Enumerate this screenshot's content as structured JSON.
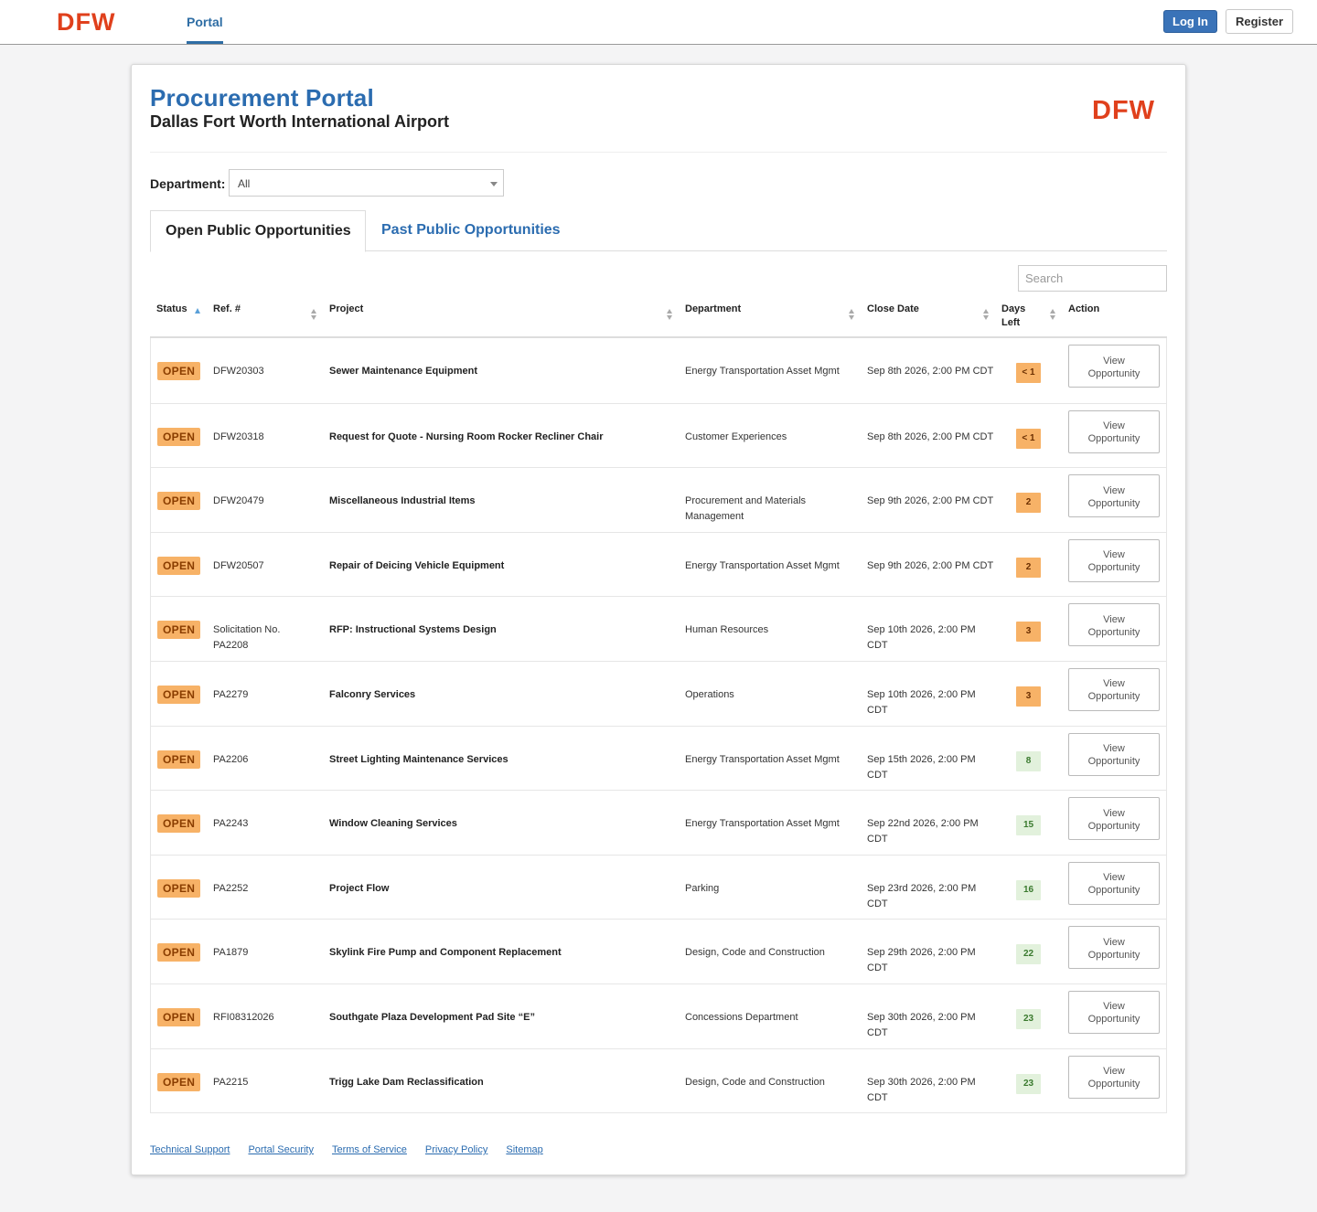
{
  "brand": {
    "logo_text": "DFW",
    "logo_color": "#e0401c",
    "accent": "#2b6cb0"
  },
  "nav": {
    "portal_tab": "Portal",
    "login_label": "Log In",
    "register_label": "Register"
  },
  "header": {
    "title": "Procurement Portal",
    "subtitle": "Dallas Fort Worth International Airport"
  },
  "filter": {
    "department_label": "Department:",
    "department_value": "All"
  },
  "tabs": {
    "open_label": "Open Public Opportunities",
    "past_label": "Past Public Opportunities"
  },
  "search": {
    "placeholder": "Search"
  },
  "table": {
    "columns": {
      "status": "Status",
      "ref": "Ref. #",
      "project": "Project",
      "department": "Department",
      "close_date": "Close Date",
      "days_left_1": "Days",
      "days_left_2": "Left",
      "action": "Action"
    },
    "action_line1": "View",
    "action_line2": "Opportunity",
    "rows": [
      {
        "status": "OPEN",
        "ref": "DFW20303",
        "project": "Sewer Maintenance Equipment",
        "department": "Energy Transportation Asset Mgmt",
        "close_date": "Sep 8th 2026, 2:00 PM CDT",
        "days_left": "< 1",
        "urgency": "warn"
      },
      {
        "status": "OPEN",
        "ref": "DFW20318",
        "project": "Request for Quote - Nursing Room Rocker Recliner Chair",
        "department": "Customer Experiences",
        "close_date": "Sep 8th 2026, 2:00 PM CDT",
        "days_left": "< 1",
        "urgency": "warn"
      },
      {
        "status": "OPEN",
        "ref": "DFW20479",
        "project": "Miscellaneous Industrial Items",
        "department": "Procurement and Materials Management",
        "close_date": "Sep 9th 2026, 2:00 PM CDT",
        "days_left": "2",
        "urgency": "warn"
      },
      {
        "status": "OPEN",
        "ref": "DFW20507",
        "project": "Repair of Deicing Vehicle Equipment",
        "department": "Energy Transportation Asset Mgmt",
        "close_date": "Sep 9th 2026, 2:00 PM CDT",
        "days_left": "2",
        "urgency": "warn"
      },
      {
        "status": "OPEN",
        "ref": "Solicitation No. PA2208",
        "project": "RFP: Instructional Systems Design",
        "department": "Human Resources",
        "close_date": "Sep 10th 2026, 2:00 PM CDT",
        "days_left": "3",
        "urgency": "warn"
      },
      {
        "status": "OPEN",
        "ref": "PA2279",
        "project": "Falconry Services",
        "department": "Operations",
        "close_date": "Sep 10th 2026, 2:00 PM CDT",
        "days_left": "3",
        "urgency": "warn"
      },
      {
        "status": "OPEN",
        "ref": "PA2206",
        "project": "Street Lighting Maintenance Services",
        "department": "Energy Transportation Asset Mgmt",
        "close_date": "Sep 15th 2026, 2:00 PM CDT",
        "days_left": "8",
        "urgency": "ok"
      },
      {
        "status": "OPEN",
        "ref": "PA2243",
        "project": "Window Cleaning Services",
        "department": "Energy Transportation Asset Mgmt",
        "close_date": "Sep 22nd 2026, 2:00 PM CDT",
        "days_left": "15",
        "urgency": "ok"
      },
      {
        "status": "OPEN",
        "ref": "PA2252",
        "project": "Project Flow",
        "department": "Parking",
        "close_date": "Sep 23rd 2026, 2:00 PM CDT",
        "days_left": "16",
        "urgency": "ok"
      },
      {
        "status": "OPEN",
        "ref": "PA1879",
        "project": "Skylink Fire Pump and Component Replacement",
        "department": "Design, Code and Construction",
        "close_date": "Sep 29th 2026, 2:00 PM CDT",
        "days_left": "22",
        "urgency": "ok"
      },
      {
        "status": "OPEN",
        "ref": "RFI08312026",
        "project": "Southgate Plaza Development Pad Site “E”",
        "department": "Concessions Department",
        "close_date": "Sep 30th 2026, 2:00 PM CDT",
        "days_left": "23",
        "urgency": "ok"
      },
      {
        "status": "OPEN",
        "ref": "PA2215",
        "project": "Trigg Lake Dam Reclassification",
        "department": "Design, Code and Construction",
        "close_date": "Sep 30th 2026, 2:00 PM CDT",
        "days_left": "23",
        "urgency": "ok"
      }
    ]
  },
  "footer": {
    "links": [
      "Technical Support",
      "Portal Security",
      "Terms of Service",
      "Privacy Policy",
      "Sitemap"
    ]
  }
}
